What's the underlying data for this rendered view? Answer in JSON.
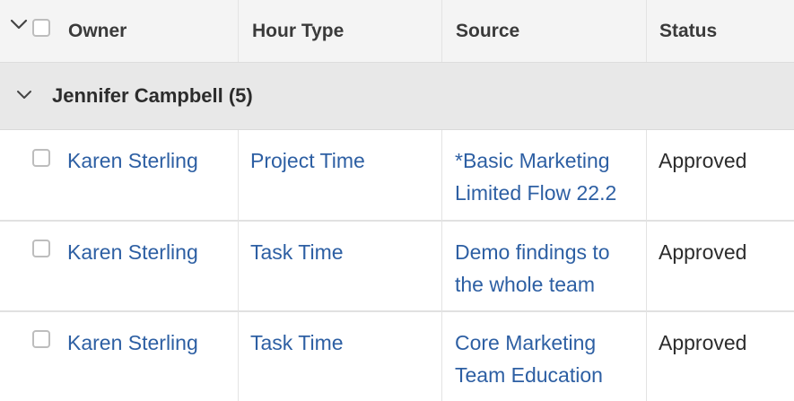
{
  "header": {
    "columns": [
      "Owner",
      "Hour Type",
      "Source",
      "Status"
    ]
  },
  "group": {
    "label": "Jennifer Campbell (5)"
  },
  "rows": [
    {
      "owner": "Karen Sterling",
      "hour_type": "Project Time",
      "source_line1": "*Basic Marketing",
      "source_line2": "Limited Flow 22.2",
      "status": "Approved"
    },
    {
      "owner": "Karen Sterling",
      "hour_type": "Task Time",
      "source_line1": "Demo findings to",
      "source_line2": "the whole team",
      "status": "Approved"
    },
    {
      "owner": "Karen Sterling",
      "hour_type": "Task Time",
      "source_line1": "Core Marketing",
      "source_line2": "Team Education",
      "status": "Approved"
    }
  ],
  "icons": {
    "header_toggle": "chevron-down-icon",
    "group_toggle": "chevron-down-icon"
  },
  "colors": {
    "link": "#2d5fa3",
    "header_bg": "#f4f4f4",
    "group_bg": "#e8e8e8"
  }
}
